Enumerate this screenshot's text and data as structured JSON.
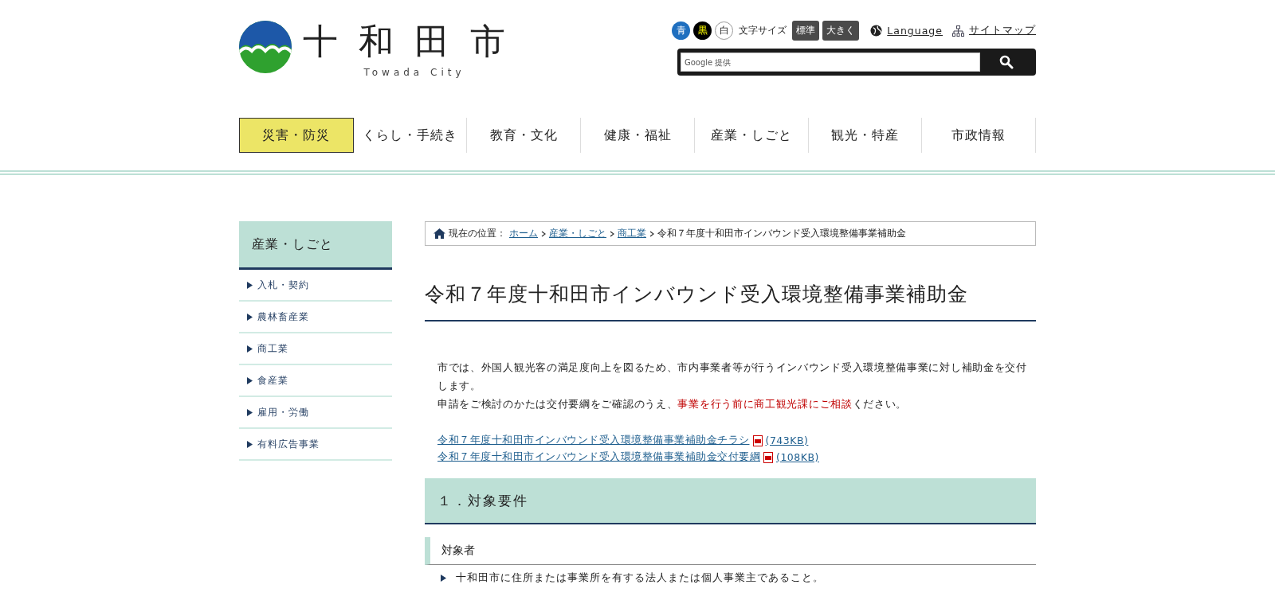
{
  "header": {
    "logo_title": "十和田市",
    "logo_subtitle": "Towada City",
    "color_themes": [
      {
        "label": "青",
        "kind": "blue"
      },
      {
        "label": "黒",
        "kind": "black"
      },
      {
        "label": "白",
        "kind": "white"
      }
    ],
    "font_size_label": "文字サイズ",
    "font_sizes": [
      "標準",
      "大きく"
    ],
    "language_link": "Language",
    "sitemap_link": "サイトマップ",
    "search": {
      "placeholder": "Google 提供"
    }
  },
  "nav": [
    {
      "label": "災害・防災",
      "selected": true
    },
    {
      "label": "くらし・手続き",
      "selected": false
    },
    {
      "label": "教育・文化",
      "selected": false
    },
    {
      "label": "健康・福祉",
      "selected": false
    },
    {
      "label": "産業・しごと",
      "selected": false
    },
    {
      "label": "観光・特産",
      "selected": false
    },
    {
      "label": "市政情報",
      "selected": false
    }
  ],
  "sidebar": {
    "title": "産業・しごと",
    "items": [
      "入札・契約",
      "農林畜産業",
      "商工業",
      "食産業",
      "雇用・労働",
      "有料広告事業"
    ]
  },
  "breadcrumb": {
    "label": "現在の位置：",
    "links": [
      "ホーム",
      "産業・しごと",
      "商工業"
    ],
    "current": "令和７年度十和田市インバウンド受入環境整備事業補助金"
  },
  "title": "令和７年度十和田市インバウンド受入環境整備事業補助金",
  "paragraphs": [
    [
      {
        "text": "市では、外国人観光客の満足度向上を図るため、市内事業者等が行うインバウンド受入環境整備事業に対し補助金を交付します。",
        "emphasis": false
      }
    ],
    [
      {
        "text": "申請をご検討のかたは交付要綱をご確認のうえ、",
        "emphasis": false
      },
      {
        "text": "事業を行う前に商工観光課にご相談",
        "emphasis": true
      },
      {
        "text": "ください。",
        "emphasis": false
      }
    ]
  ],
  "files": [
    {
      "name": "令和７年度十和田市インバウンド受入環境整備事業補助金チラシ",
      "size": "(743KB)"
    },
    {
      "name": "令和７年度十和田市インバウンド受入環境整備事業補助金交付要綱",
      "size": "(108KB)"
    }
  ],
  "section": {
    "heading": "１．対象要件",
    "subheading": "対象者",
    "bullets": [
      "十和田市に住所または事業所を有する法人または個人事業主であること。"
    ]
  }
}
